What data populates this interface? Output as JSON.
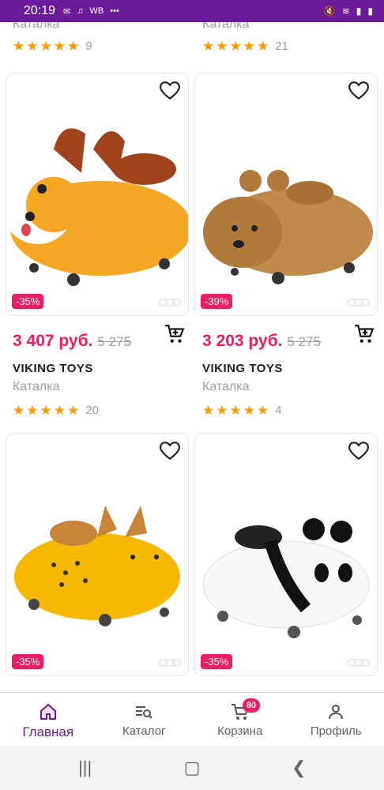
{
  "status": {
    "time": "20:19",
    "notif_label": "WB",
    "battery_icon": "battery-icon"
  },
  "top": {
    "left": {
      "category": "Каталка",
      "rating_count": "9"
    },
    "right": {
      "category": "Каталка",
      "rating_count": "21"
    }
  },
  "products": [
    {
      "discount": "-35%",
      "price": "3 407 руб.",
      "old_price": "5 275",
      "brand": "VIKING TOYS",
      "category": "Каталка",
      "rating_count": "20",
      "color": "#f5a623",
      "kind": "dog"
    },
    {
      "discount": "-39%",
      "price": "3 203 руб.",
      "old_price": "5 275",
      "brand": "VIKING TOYS",
      "category": "Каталка",
      "rating_count": "4",
      "color": "#c08a4a",
      "kind": "bear"
    },
    {
      "discount": "-35%",
      "color": "#f7b800",
      "kind": "cheetah"
    },
    {
      "discount": "-35%",
      "color": "#ffffff",
      "kind": "panda"
    }
  ],
  "tabs": [
    {
      "label": "Главная",
      "icon": "home-icon",
      "active": true
    },
    {
      "label": "Каталог",
      "icon": "catalog-search-icon"
    },
    {
      "label": "Корзина",
      "icon": "cart-icon",
      "badge": "80"
    },
    {
      "label": "Профиль",
      "icon": "profile-icon"
    }
  ],
  "accent": "#6a1b9a",
  "price_color": "#e91e63"
}
